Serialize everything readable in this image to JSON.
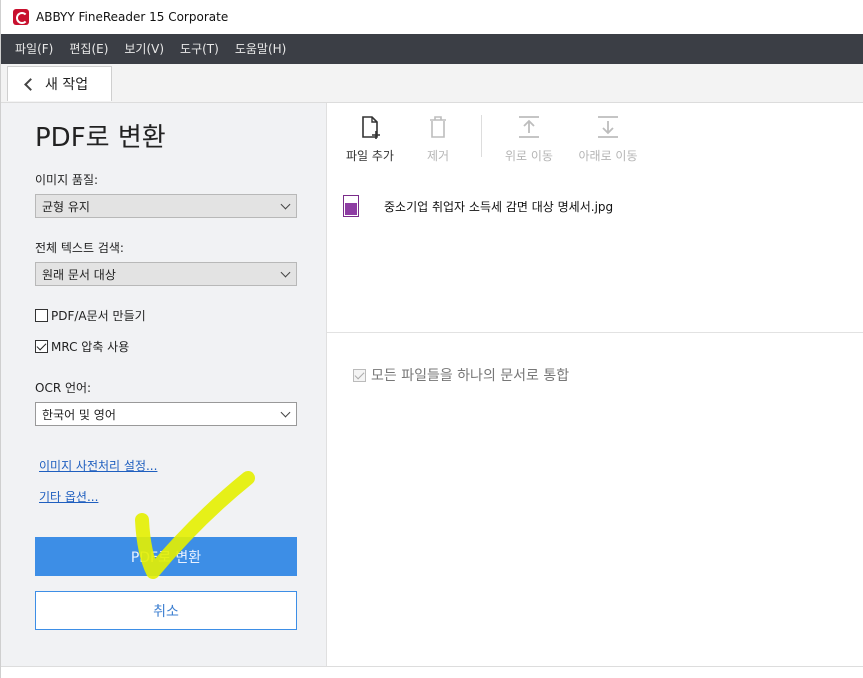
{
  "window": {
    "title": "ABBYY FineReader 15 Corporate"
  },
  "menubar": {
    "items": [
      "파일(F)",
      "편집(E)",
      "보기(V)",
      "도구(T)",
      "도움말(H)"
    ]
  },
  "tabbar": {
    "back_label": "새 작업"
  },
  "left_panel": {
    "title": "PDF로 변환",
    "image_quality": {
      "label": "이미지 품질:",
      "value": "균형 유지"
    },
    "fulltext_search": {
      "label": "전체 텍스트 검색:",
      "value": "원래 문서 대상"
    },
    "pdfa_checkbox": {
      "label": "PDF/A문서 만들기",
      "checked": false
    },
    "mrc_checkbox": {
      "label": "MRC 압축 사용",
      "checked": true
    },
    "ocr_language": {
      "label": "OCR 언어:",
      "value": "한국어 및 영어"
    },
    "links": {
      "preprocess": "이미지 사전처리 설정...",
      "other_options": "기타 옵션..."
    },
    "convert_button": "PDF로 변환",
    "cancel_button": "취소"
  },
  "toolbar": {
    "add_file": "파일 추가",
    "remove": "제거",
    "move_up": "위로 이동",
    "move_down": "아래로 이동"
  },
  "files": [
    {
      "name": "중소기업 취업자 소득세 감면 대상 명세서.jpg",
      "icon": "image-file-icon"
    }
  ],
  "merge_option": {
    "label": "모든 파일들을 하나의 문서로 통합",
    "checked": true
  },
  "colors": {
    "menubar": "#3b3e45",
    "accent": "#3d8ee6",
    "annotation": "#e4f000"
  }
}
